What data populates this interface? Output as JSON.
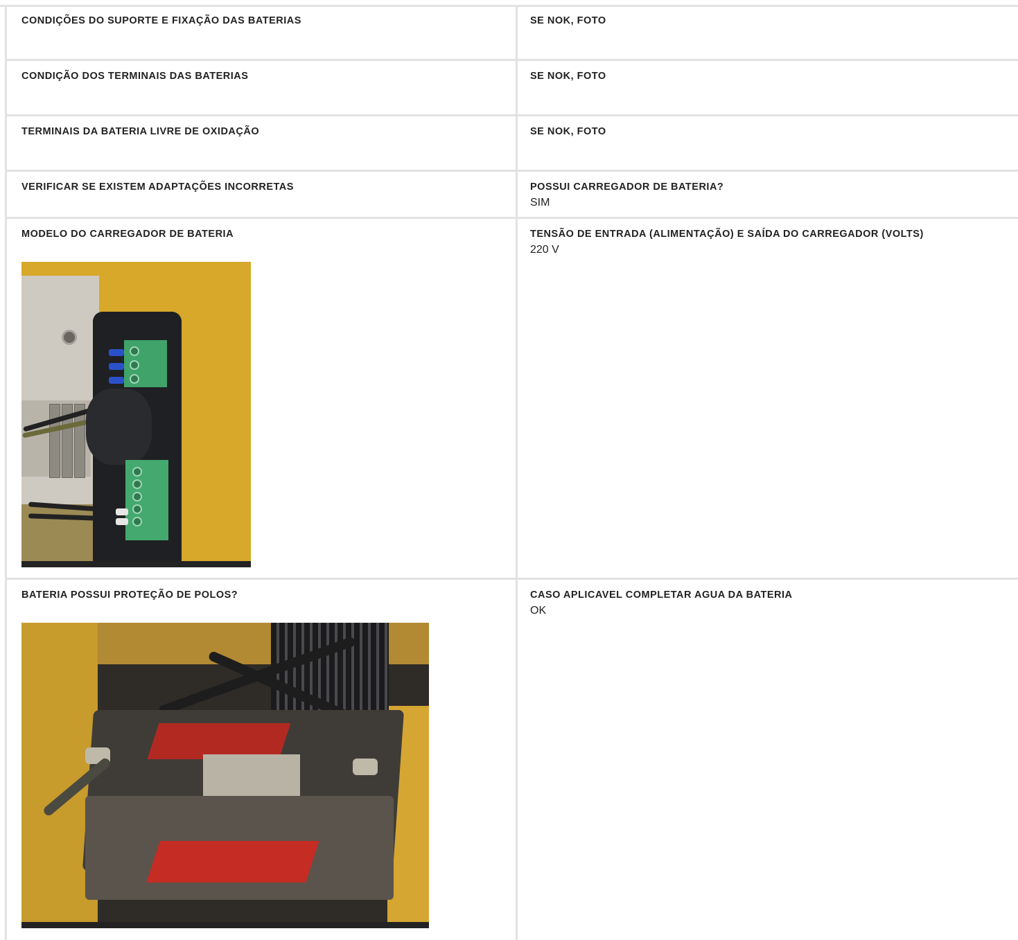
{
  "rows": [
    {
      "left": {
        "label": "CONDIÇÕES DO SUPORTE E FIXAÇÃO DAS BATERIAS"
      },
      "right": {
        "label": "SE NOK, FOTO"
      }
    },
    {
      "left": {
        "label": "CONDIÇÃO DOS TERMINAIS DAS BATERIAS"
      },
      "right": {
        "label": "SE NOK, FOTO"
      }
    },
    {
      "left": {
        "label": "TERMINAIS DA BATERIA LIVRE DE OXIDAÇÃO"
      },
      "right": {
        "label": "SE NOK, FOTO"
      }
    },
    {
      "left": {
        "label": "VERIFICAR SE EXISTEM ADAPTAÇÕES INCORRETAS"
      },
      "right": {
        "label": "POSSUI CARREGADOR DE BATERIA?",
        "value": "SIM"
      }
    },
    {
      "left": {
        "label": "MODELO DO CARREGADOR DE BATERIA",
        "photo": "battery-charger-photo"
      },
      "right": {
        "label": "TENSÃO DE ENTRADA (ALIMENTAÇÃO) E SAÍDA DO CARREGADOR (VOLTS)",
        "value": "220 V"
      }
    },
    {
      "left": {
        "label": "BATERIA POSSUI PROTEÇÃO DE POLOS?",
        "photo": "battery-poles-photo"
      },
      "right": {
        "label": "CASO APLICAVEL COMPLETAR AGUA DA BATERIA",
        "value": "OK"
      }
    }
  ],
  "colors": {
    "grid_line": "#e2e2e2",
    "text": "#222222"
  }
}
